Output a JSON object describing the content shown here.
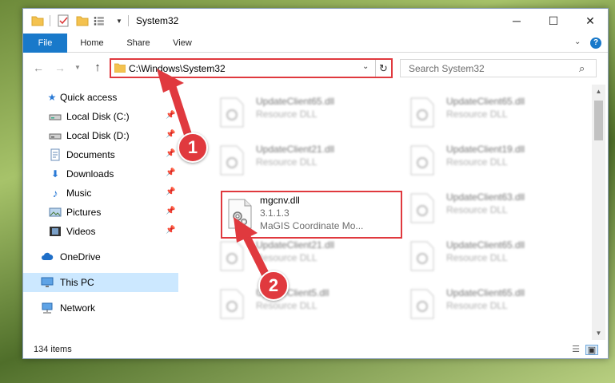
{
  "window": {
    "title": "System32",
    "controls": {
      "minimize": "─",
      "maximize": "☐",
      "close": "✕"
    }
  },
  "ribbon": {
    "tabs": {
      "file": "File",
      "home": "Home",
      "share": "Share",
      "view": "View"
    },
    "expand": "⌄",
    "help": "?"
  },
  "nav": {
    "address": "C:\\Windows\\System32",
    "search_placeholder": "Search System32"
  },
  "sidebar": {
    "items": [
      {
        "label": "Quick access",
        "icon": "star-icon",
        "pinned": false
      },
      {
        "label": "Local Disk (C:)",
        "icon": "drive-icon",
        "pinned": true
      },
      {
        "label": "Local Disk (D:)",
        "icon": "drive-icon",
        "pinned": true
      },
      {
        "label": "Documents",
        "icon": "documents-icon",
        "pinned": true
      },
      {
        "label": "Downloads",
        "icon": "download-icon",
        "pinned": true
      },
      {
        "label": "Music",
        "icon": "music-icon",
        "pinned": true
      },
      {
        "label": "Pictures",
        "icon": "pictures-icon",
        "pinned": true
      },
      {
        "label": "Videos",
        "icon": "videos-icon",
        "pinned": true
      },
      {
        "label": "OneDrive",
        "icon": "cloud-icon",
        "pinned": false
      },
      {
        "label": "This PC",
        "icon": "computer-icon",
        "pinned": false,
        "selected": true
      },
      {
        "label": "Network",
        "icon": "network-icon",
        "pinned": false
      }
    ]
  },
  "files": [
    {
      "name": "UpdateClient65.dll",
      "type": "Resource DLL"
    },
    {
      "name": "UpdateClient65.dll",
      "type": "Resource DLL"
    },
    {
      "name": "UpdateClient21.dll",
      "type": "Resource DLL"
    },
    {
      "name": "UpdateClient19.dll",
      "type": "Resource DLL"
    },
    {
      "name": "mgcnv.dll",
      "version": "3.1.1.3",
      "type": "MaGIS Coordinate Mo...",
      "highlighted": true
    },
    {
      "name": "UpdateClient63.dll",
      "type": "Resource DLL"
    },
    {
      "name": "UpdateClient21.dll",
      "type": "Resource DLL"
    },
    {
      "name": "UpdateClient65.dll",
      "type": "Resource DLL"
    },
    {
      "name": "UpdateClient5.dll",
      "type": "Resource DLL"
    },
    {
      "name": "UpdateClient65.dll",
      "type": "Resource DLL"
    }
  ],
  "status": {
    "item_count": "134 items"
  },
  "annotations": {
    "step1": "1",
    "step2": "2"
  },
  "colors": {
    "accent": "#1979ca",
    "highlight": "#e0393e",
    "selection": "#cce8ff"
  }
}
